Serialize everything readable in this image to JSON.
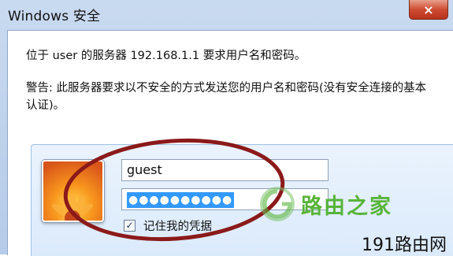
{
  "window": {
    "title": "Windows 安全",
    "close_glyph": "×"
  },
  "message": {
    "line1": "位于 user 的服务器 192.168.1.1 要求用户名和密码。",
    "warning": "警告: 此服务器要求以不安全的方式发送您的用户名和密码(没有安全连接的基本认证)。"
  },
  "credentials": {
    "username": "guest",
    "password_masked": "●●●●●●●●●●",
    "remember_label": "记住我的凭据",
    "remember_checked": true,
    "check_glyph": "✓"
  },
  "watermark": {
    "brand": "路由之家",
    "site": "191路由网"
  },
  "colors": {
    "accent_selection": "#3399ff",
    "annotation_red": "#8b1a1a",
    "brand_green": "#58b43a"
  },
  "icons": [
    "close-icon",
    "user-avatar-flower-icon",
    "checkbox-check-icon",
    "router-logo-icon"
  ]
}
